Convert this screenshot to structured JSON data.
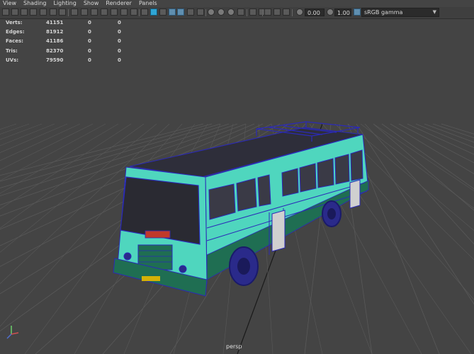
{
  "menubar": {
    "items": [
      "View",
      "Shading",
      "Lighting",
      "Show",
      "Renderer",
      "Panels"
    ]
  },
  "toolbar": {
    "exposure_value": "0.00",
    "gamma_value": "1.00",
    "color_space": "sRGB gamma"
  },
  "hud": {
    "rows": [
      {
        "label": "Verts:",
        "v1": "41151",
        "v2": "0",
        "v3": "0"
      },
      {
        "label": "Edges:",
        "v1": "81912",
        "v2": "0",
        "v3": "0"
      },
      {
        "label": "Faces:",
        "v1": "41186",
        "v2": "0",
        "v3": "0"
      },
      {
        "label": "Tris:",
        "v1": "82370",
        "v2": "0",
        "v3": "0"
      },
      {
        "label": "UVs:",
        "v1": "79590",
        "v2": "0",
        "v3": "0"
      }
    ]
  },
  "viewport": {
    "camera_label": "persp"
  },
  "colors": {
    "background": "#444444",
    "grid": "#595959",
    "grid_axis": "#1a1a1a",
    "wireframe": "#2b2ab8",
    "bus_teal": "#4fd6be",
    "bus_green": "#1f6e52",
    "bus_roof": "#2e2e3a"
  }
}
